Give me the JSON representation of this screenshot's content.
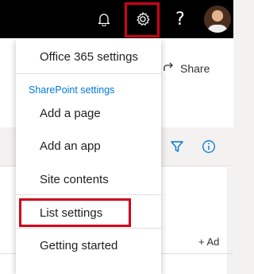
{
  "topbar": {
    "icons": [
      "notification-bell-icon",
      "settings-gear-icon",
      "help-icon"
    ],
    "help_glyph": "?"
  },
  "background": {
    "share_label": "Share",
    "add_column_label": "+ Ad"
  },
  "settings_menu": {
    "office365_settings": "Office 365 settings",
    "section_label": "SharePoint settings",
    "items": [
      {
        "label": "Add a page"
      },
      {
        "label": "Add an app"
      },
      {
        "label": "Site contents"
      },
      {
        "label": "List settings"
      },
      {
        "label": "Getting started"
      }
    ]
  },
  "colors": {
    "suite_bar": "#000000",
    "highlight_box": "#d0021b",
    "section_label": "#0078d4"
  }
}
